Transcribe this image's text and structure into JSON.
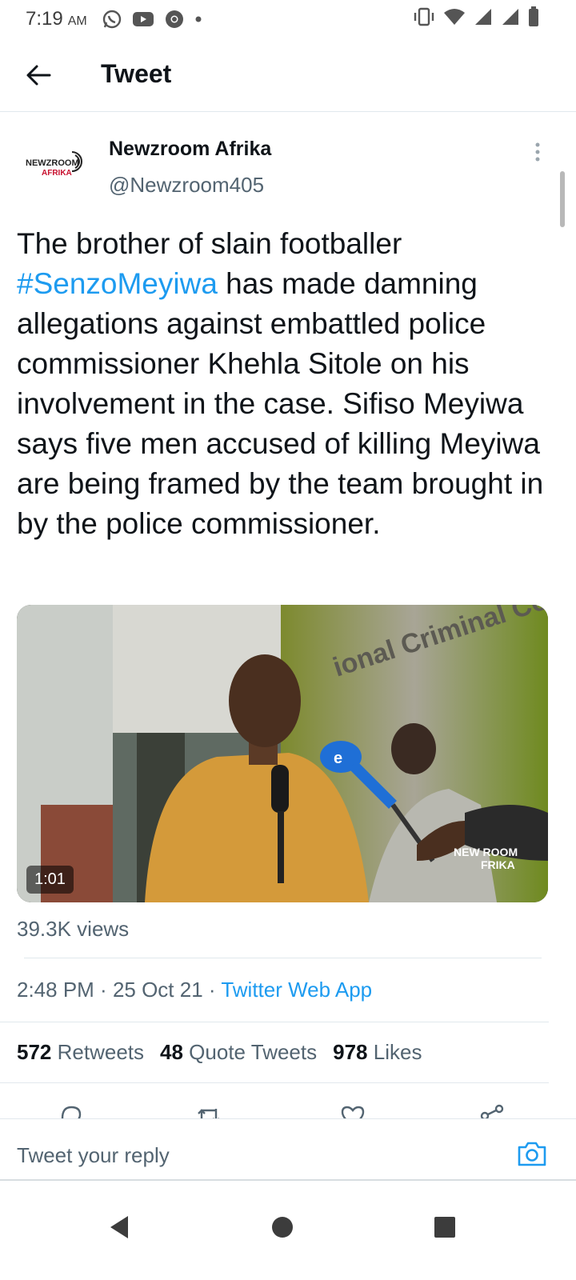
{
  "status_bar": {
    "time": "7:19",
    "ampm": "AM",
    "left_icons": [
      "whatsapp-icon",
      "youtube-icon",
      "chrome-icon",
      "dot-icon"
    ],
    "right_icons": [
      "vibrate-icon",
      "wifi-icon",
      "signal-icon",
      "signal-icon",
      "battery-icon"
    ]
  },
  "header": {
    "back_icon": "arrow-left-icon",
    "title": "Tweet"
  },
  "tweet": {
    "author_name": "Newzroom Afrika",
    "author_handle": "@Newzroom405",
    "avatar_text_line1": "NEWZROOM",
    "avatar_text_line2": "AFRIKA",
    "text_before": "The brother of slain footballer ",
    "hashtag": "#SenzoMeyiwa",
    "text_after": " has made damning allegations against embattled police commissioner Khehla Sitole on his involvement in the case. Sifiso Meyiwa says five men accused of killing Meyiwa are being framed by the team brought in by the police commissioner.",
    "video": {
      "duration": "1:01",
      "wall_text": "ional Criminal Co",
      "watermark_line1": "NEW ROOM",
      "watermark_line2": "FRIKA"
    },
    "views": "39.3K views",
    "time": "2:48 PM",
    "date": "25 Oct 21",
    "source": "Twitter Web App",
    "stats": {
      "retweets_count": "572",
      "retweets_label": "Retweets",
      "quotes_count": "48",
      "quotes_label": "Quote Tweets",
      "likes_count": "978",
      "likes_label": "Likes"
    }
  },
  "reply": {
    "placeholder": "Tweet your reply"
  },
  "colors": {
    "accent": "#1d9bf0",
    "secondary_text": "#536471",
    "primary_text": "#0f1419"
  }
}
